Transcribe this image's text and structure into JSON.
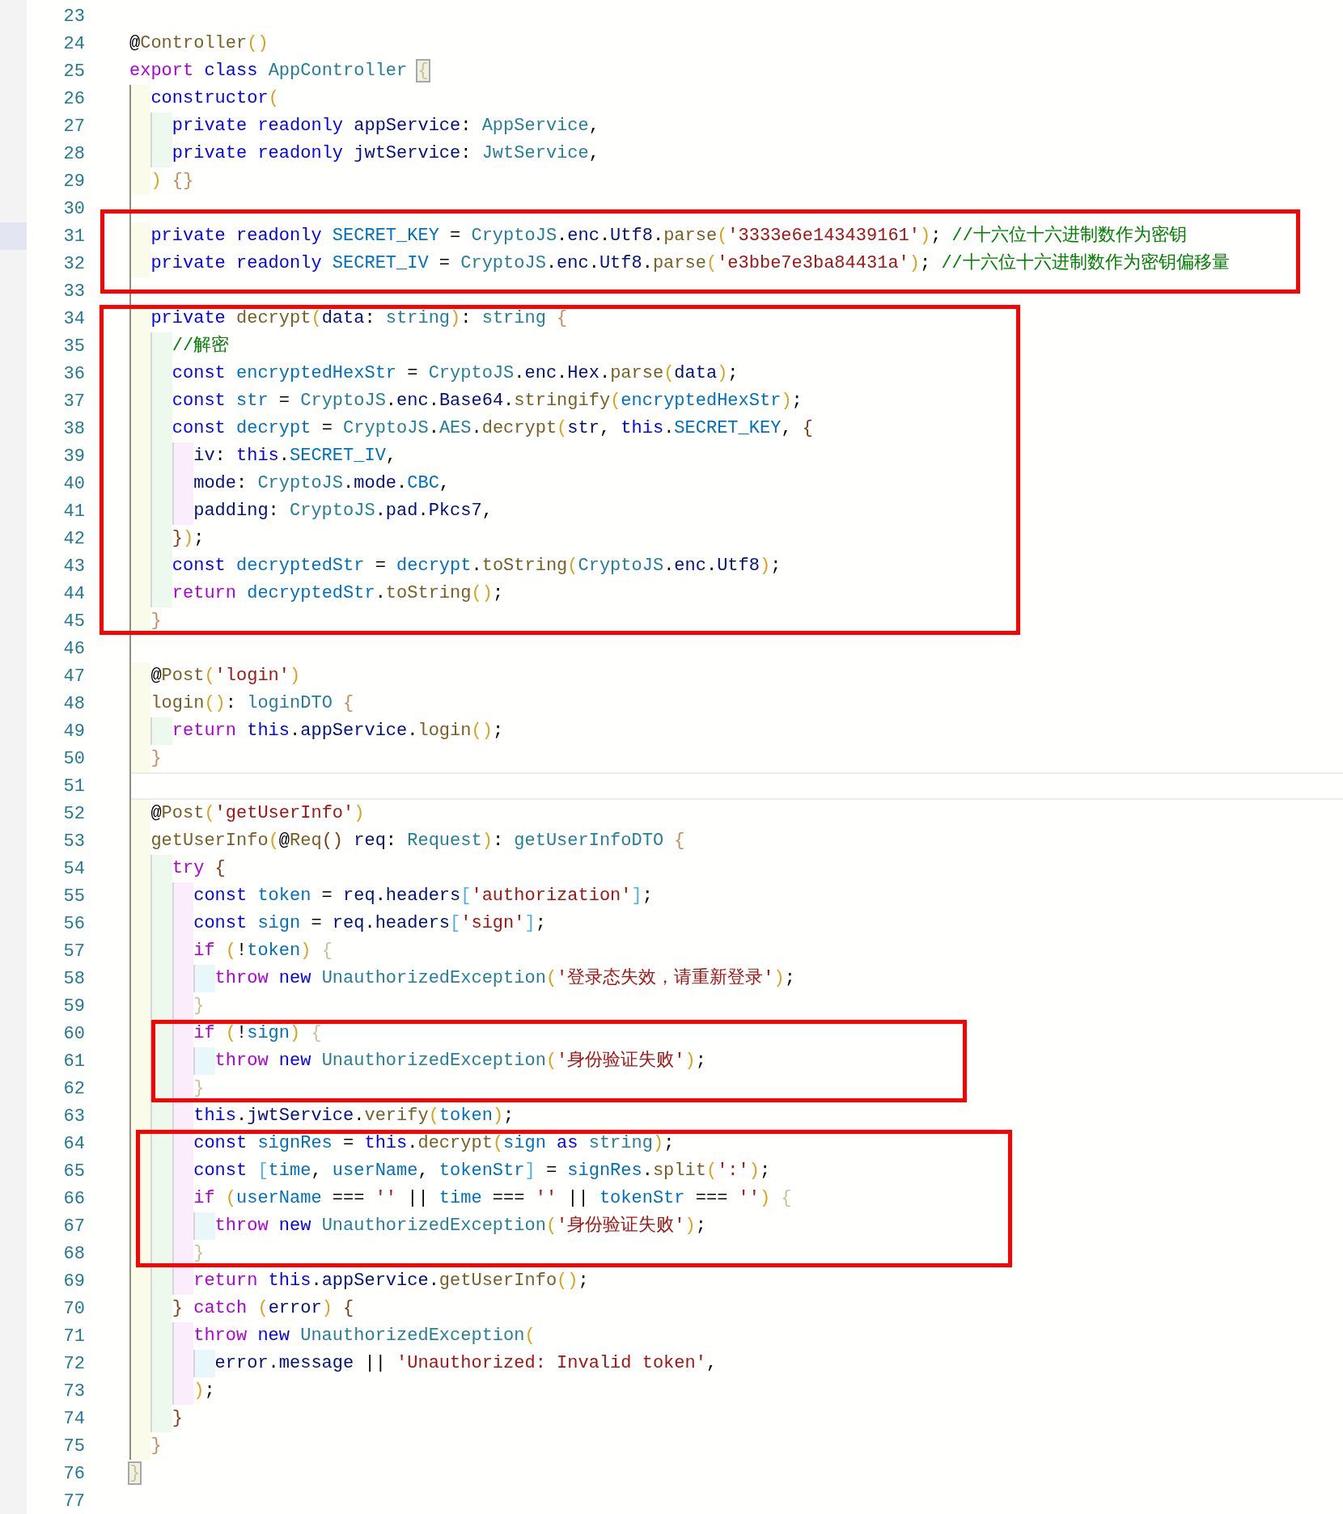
{
  "blocks": [
    {
      "boxed": false,
      "lines": [
        {
          "number": "23",
          "kind": "plain"
        },
        {
          "number": "24",
          "kind": "plain",
          "tokens": [
            {
              "text": "@",
              "kind": "punct"
            },
            {
              "text": "Controller",
              "kind": "function"
            },
            {
              "text": "()",
              "kind": "bracket-gold"
            }
          ]
        },
        {
          "number": "25",
          "kind": "plain",
          "tokens": [
            {
              "text": "export ",
              "kind": "control"
            },
            {
              "text": "class ",
              "kind": "keyword"
            },
            {
              "text": "AppController ",
              "kind": "type"
            },
            {
              "text": "{",
              "kind": "bracket-match"
            }
          ]
        },
        {
          "number": "26",
          "kind": "plain",
          "tokens": [
            {
              "text": "  constructor",
              "kind": "keyword"
            },
            {
              "text": "(",
              "kind": "bracket-gold"
            }
          ]
        },
        {
          "number": "27",
          "kind": "plain",
          "tokens": [
            {
              "text": "    private readonly ",
              "kind": "keyword"
            },
            {
              "text": "appService",
              "kind": "variable"
            },
            {
              "text": ": ",
              "kind": "punct"
            },
            {
              "text": "AppService",
              "kind": "type"
            },
            {
              "text": ",",
              "kind": "punct"
            }
          ]
        },
        {
          "number": "28",
          "kind": "plain",
          "tokens": [
            {
              "text": "    private readonly ",
              "kind": "keyword"
            },
            {
              "text": "jwtService",
              "kind": "variable"
            },
            {
              "text": ": ",
              "kind": "punct"
            },
            {
              "text": "JwtService",
              "kind": "type"
            },
            {
              "text": ",",
              "kind": "punct"
            }
          ]
        },
        {
          "number": "29",
          "kind": "plain",
          "tokens": [
            {
              "text": "  ) ",
              "kind": "bracket-gold"
            },
            {
              "text": "{}",
              "kind": "bracket-tan"
            }
          ]
        },
        {
          "number": "30",
          "kind": "plain"
        }
      ]
    },
    {
      "boxed": true,
      "lines": [
        {
          "number": "31",
          "kind": "marked",
          "tokens": [
            {
              "text": "  private readonly ",
              "kind": "keyword"
            },
            {
              "text": "SECRET_KEY",
              "kind": "constant"
            },
            {
              "text": " = ",
              "kind": "punct"
            },
            {
              "text": "CryptoJS",
              "kind": "type"
            },
            {
              "text": ".",
              "kind": "punct"
            },
            {
              "text": "enc",
              "kind": "variable"
            },
            {
              "text": ".",
              "kind": "punct"
            },
            {
              "text": "Utf8",
              "kind": "variable"
            },
            {
              "text": ".",
              "kind": "punct"
            },
            {
              "text": "parse",
              "kind": "function"
            },
            {
              "text": "(",
              "kind": "bracket-gold"
            },
            {
              "text": "'3333e6e143439161'",
              "kind": "string"
            },
            {
              "text": ")",
              "kind": "bracket-gold"
            },
            {
              "text": "; ",
              "kind": "punct"
            },
            {
              "text": "//十六位十六进制数作为密钥",
              "kind": "comment"
            }
          ]
        },
        {
          "number": "32",
          "kind": "plain",
          "tokens": [
            {
              "text": "  private readonly ",
              "kind": "keyword"
            },
            {
              "text": "SECRET_IV",
              "kind": "constant"
            },
            {
              "text": " = ",
              "kind": "punct"
            },
            {
              "text": "CryptoJS",
              "kind": "type"
            },
            {
              "text": ".",
              "kind": "punct"
            },
            {
              "text": "enc",
              "kind": "variable"
            },
            {
              "text": ".",
              "kind": "punct"
            },
            {
              "text": "Utf8",
              "kind": "variable"
            },
            {
              "text": ".",
              "kind": "punct"
            },
            {
              "text": "parse",
              "kind": "function"
            },
            {
              "text": "(",
              "kind": "bracket-gold"
            },
            {
              "text": "'e3bbe7e3ba84431a'",
              "kind": "string"
            },
            {
              "text": ")",
              "kind": "bracket-gold"
            },
            {
              "text": "; ",
              "kind": "punct"
            },
            {
              "text": "//十六位十六进制数作为密钥偏移量",
              "kind": "comment"
            }
          ]
        },
        {
          "number": "33",
          "kind": "plain"
        }
      ]
    },
    {
      "boxed": true,
      "lines": [
        {
          "number": "34",
          "kind": "plain",
          "tokens": [
            {
              "text": "  private ",
              "kind": "keyword"
            },
            {
              "text": "decrypt",
              "kind": "function"
            },
            {
              "text": "(",
              "kind": "bracket-gold"
            },
            {
              "text": "data",
              "kind": "variable"
            },
            {
              "text": ": ",
              "kind": "punct"
            },
            {
              "text": "string",
              "kind": "type"
            },
            {
              "text": ")",
              "kind": "bracket-gold"
            },
            {
              "text": ": ",
              "kind": "punct"
            },
            {
              "text": "string ",
              "kind": "type"
            },
            {
              "text": "{",
              "kind": "bracket-tan"
            }
          ]
        },
        {
          "number": "35",
          "kind": "plain",
          "tokens": [
            {
              "text": "    //解密",
              "kind": "comment"
            }
          ]
        },
        {
          "number": "36",
          "kind": "plain",
          "tokens": [
            {
              "text": "    const ",
              "kind": "keyword"
            },
            {
              "text": "encryptedHexStr",
              "kind": "constant"
            },
            {
              "text": " = ",
              "kind": "punct"
            },
            {
              "text": "CryptoJS",
              "kind": "type"
            },
            {
              "text": ".",
              "kind": "punct"
            },
            {
              "text": "enc",
              "kind": "variable"
            },
            {
              "text": ".",
              "kind": "punct"
            },
            {
              "text": "Hex",
              "kind": "variable"
            },
            {
              "text": ".",
              "kind": "punct"
            },
            {
              "text": "parse",
              "kind": "function"
            },
            {
              "text": "(",
              "kind": "bracket-gold"
            },
            {
              "text": "data",
              "kind": "variable"
            },
            {
              "text": ")",
              "kind": "bracket-gold"
            },
            {
              "text": ";",
              "kind": "punct"
            }
          ]
        },
        {
          "number": "37",
          "kind": "plain",
          "tokens": [
            {
              "text": "    const ",
              "kind": "keyword"
            },
            {
              "text": "str",
              "kind": "constant"
            },
            {
              "text": " = ",
              "kind": "punct"
            },
            {
              "text": "CryptoJS",
              "kind": "type"
            },
            {
              "text": ".",
              "kind": "punct"
            },
            {
              "text": "enc",
              "kind": "variable"
            },
            {
              "text": ".",
              "kind": "punct"
            },
            {
              "text": "Base64",
              "kind": "variable"
            },
            {
              "text": ".",
              "kind": "punct"
            },
            {
              "text": "stringify",
              "kind": "function"
            },
            {
              "text": "(",
              "kind": "bracket-gold"
            },
            {
              "text": "encryptedHexStr",
              "kind": "constant"
            },
            {
              "text": ")",
              "kind": "bracket-gold"
            },
            {
              "text": ";",
              "kind": "punct"
            }
          ]
        },
        {
          "number": "38",
          "kind": "plain",
          "tokens": [
            {
              "text": "    const ",
              "kind": "keyword"
            },
            {
              "text": "decrypt",
              "kind": "constant"
            },
            {
              "text": " = ",
              "kind": "punct"
            },
            {
              "text": "CryptoJS",
              "kind": "type"
            },
            {
              "text": ".",
              "kind": "punct"
            },
            {
              "text": "AES",
              "kind": "type"
            },
            {
              "text": ".",
              "kind": "punct"
            },
            {
              "text": "decrypt",
              "kind": "function"
            },
            {
              "text": "(",
              "kind": "bracket-gold"
            },
            {
              "text": "str",
              "kind": "variable"
            },
            {
              "text": ", ",
              "kind": "punct"
            },
            {
              "text": "this",
              "kind": "keyword"
            },
            {
              "text": ".",
              "kind": "punct"
            },
            {
              "text": "SECRET_KEY",
              "kind": "constant"
            },
            {
              "text": ", ",
              "kind": "punct"
            },
            {
              "text": "{",
              "kind": "bracket-brown"
            }
          ]
        },
        {
          "number": "39",
          "kind": "plain",
          "tokens": [
            {
              "text": "      iv",
              "kind": "variable"
            },
            {
              "text": ": ",
              "kind": "punct"
            },
            {
              "text": "this",
              "kind": "keyword"
            },
            {
              "text": ".",
              "kind": "punct"
            },
            {
              "text": "SECRET_IV",
              "kind": "constant"
            },
            {
              "text": ",",
              "kind": "punct"
            }
          ]
        },
        {
          "number": "40",
          "kind": "plain",
          "tokens": [
            {
              "text": "      mode",
              "kind": "variable"
            },
            {
              "text": ": ",
              "kind": "punct"
            },
            {
              "text": "CryptoJS",
              "kind": "type"
            },
            {
              "text": ".",
              "kind": "punct"
            },
            {
              "text": "mode",
              "kind": "variable"
            },
            {
              "text": ".",
              "kind": "punct"
            },
            {
              "text": "CBC",
              "kind": "constant"
            },
            {
              "text": ",",
              "kind": "punct"
            }
          ]
        },
        {
          "number": "41",
          "kind": "plain",
          "tokens": [
            {
              "text": "      padding",
              "kind": "variable"
            },
            {
              "text": ": ",
              "kind": "punct"
            },
            {
              "text": "CryptoJS",
              "kind": "type"
            },
            {
              "text": ".",
              "kind": "punct"
            },
            {
              "text": "pad",
              "kind": "variable"
            },
            {
              "text": ".",
              "kind": "punct"
            },
            {
              "text": "Pkcs7",
              "kind": "variable"
            },
            {
              "text": ",",
              "kind": "punct"
            }
          ]
        },
        {
          "number": "42",
          "kind": "plain",
          "tokens": [
            {
              "text": "    }",
              "kind": "bracket-brown"
            },
            {
              "text": ")",
              "kind": "bracket-gold"
            },
            {
              "text": ";",
              "kind": "punct"
            }
          ]
        },
        {
          "number": "43",
          "kind": "plain",
          "tokens": [
            {
              "text": "    const ",
              "kind": "keyword"
            },
            {
              "text": "decryptedStr",
              "kind": "constant"
            },
            {
              "text": " = ",
              "kind": "punct"
            },
            {
              "text": "decrypt",
              "kind": "constant"
            },
            {
              "text": ".",
              "kind": "punct"
            },
            {
              "text": "toString",
              "kind": "function"
            },
            {
              "text": "(",
              "kind": "bracket-gold"
            },
            {
              "text": "CryptoJS",
              "kind": "type"
            },
            {
              "text": ".",
              "kind": "punct"
            },
            {
              "text": "enc",
              "kind": "variable"
            },
            {
              "text": ".",
              "kind": "punct"
            },
            {
              "text": "Utf8",
              "kind": "variable"
            },
            {
              "text": ")",
              "kind": "bracket-gold"
            },
            {
              "text": ";",
              "kind": "punct"
            }
          ]
        },
        {
          "number": "44",
          "kind": "plain",
          "tokens": [
            {
              "text": "    return ",
              "kind": "control"
            },
            {
              "text": "decryptedStr",
              "kind": "constant"
            },
            {
              "text": ".",
              "kind": "punct"
            },
            {
              "text": "toString",
              "kind": "function"
            },
            {
              "text": "()",
              "kind": "bracket-gold"
            },
            {
              "text": ";",
              "kind": "punct"
            }
          ]
        },
        {
          "number": "45",
          "kind": "plain",
          "tokens": [
            {
              "text": "  }",
              "kind": "bracket-tan"
            }
          ]
        }
      ]
    },
    {
      "boxed": false,
      "lines": [
        {
          "number": "46",
          "kind": "plain"
        },
        {
          "number": "47",
          "kind": "plain",
          "tokens": [
            {
              "text": "  @",
              "kind": "punct"
            },
            {
              "text": "Post",
              "kind": "function"
            },
            {
              "text": "(",
              "kind": "bracket-gold"
            },
            {
              "text": "'login'",
              "kind": "string"
            },
            {
              "text": ")",
              "kind": "bracket-gold"
            }
          ]
        },
        {
          "number": "48",
          "kind": "plain",
          "tokens": [
            {
              "text": "  login",
              "kind": "function"
            },
            {
              "text": "()",
              "kind": "bracket-gold"
            },
            {
              "text": ": ",
              "kind": "punct"
            },
            {
              "text": "loginDTO ",
              "kind": "type"
            },
            {
              "text": "{",
              "kind": "bracket-tan"
            }
          ]
        },
        {
          "number": "49",
          "kind": "plain",
          "tokens": [
            {
              "text": "    return ",
              "kind": "control"
            },
            {
              "text": "this",
              "kind": "keyword"
            },
            {
              "text": ".",
              "kind": "punct"
            },
            {
              "text": "appService",
              "kind": "variable"
            },
            {
              "text": ".",
              "kind": "punct"
            },
            {
              "text": "login",
              "kind": "function"
            },
            {
              "text": "()",
              "kind": "bracket-gold"
            },
            {
              "text": ";",
              "kind": "punct"
            }
          ]
        },
        {
          "number": "50",
          "kind": "plain",
          "tokens": [
            {
              "text": "  }",
              "kind": "bracket-tan"
            }
          ]
        },
        {
          "number": "51",
          "kind": "current"
        },
        {
          "number": "52",
          "kind": "plain",
          "tokens": [
            {
              "text": "  @",
              "kind": "punct"
            },
            {
              "text": "Post",
              "kind": "function"
            },
            {
              "text": "(",
              "kind": "bracket-gold"
            },
            {
              "text": "'getUserInfo'",
              "kind": "string"
            },
            {
              "text": ")",
              "kind": "bracket-gold"
            }
          ]
        },
        {
          "number": "53",
          "kind": "plain",
          "tokens": [
            {
              "text": "  getUserInfo",
              "kind": "function"
            },
            {
              "text": "(",
              "kind": "bracket-gold"
            },
            {
              "text": "@",
              "kind": "punct"
            },
            {
              "text": "Req",
              "kind": "function"
            },
            {
              "text": "() ",
              "kind": "bracket-brown"
            },
            {
              "text": "req",
              "kind": "variable"
            },
            {
              "text": ": ",
              "kind": "punct"
            },
            {
              "text": "Request",
              "kind": "type"
            },
            {
              "text": ")",
              "kind": "bracket-gold"
            },
            {
              "text": ": ",
              "kind": "punct"
            },
            {
              "text": "getUserInfoDTO ",
              "kind": "type"
            },
            {
              "text": "{",
              "kind": "bracket-tan"
            }
          ]
        },
        {
          "number": "54",
          "kind": "plain",
          "tokens": [
            {
              "text": "    try ",
              "kind": "control"
            },
            {
              "text": "{",
              "kind": "bracket-brown"
            }
          ]
        },
        {
          "number": "55",
          "kind": "plain",
          "tokens": [
            {
              "text": "      const ",
              "kind": "keyword"
            },
            {
              "text": "token",
              "kind": "constant"
            },
            {
              "text": " = ",
              "kind": "punct"
            },
            {
              "text": "req",
              "kind": "variable"
            },
            {
              "text": ".",
              "kind": "punct"
            },
            {
              "text": "headers",
              "kind": "variable"
            },
            {
              "text": "[",
              "kind": "bracket-blue"
            },
            {
              "text": "'authorization'",
              "kind": "string"
            },
            {
              "text": "]",
              "kind": "bracket-blue"
            },
            {
              "text": ";",
              "kind": "punct"
            }
          ]
        },
        {
          "number": "56",
          "kind": "plain",
          "tokens": [
            {
              "text": "      const ",
              "kind": "keyword"
            },
            {
              "text": "sign",
              "kind": "constant"
            },
            {
              "text": " = ",
              "kind": "punct"
            },
            {
              "text": "req",
              "kind": "variable"
            },
            {
              "text": ".",
              "kind": "punct"
            },
            {
              "text": "headers",
              "kind": "variable"
            },
            {
              "text": "[",
              "kind": "bracket-blue"
            },
            {
              "text": "'sign'",
              "kind": "string"
            },
            {
              "text": "]",
              "kind": "bracket-blue"
            },
            {
              "text": ";",
              "kind": "punct"
            }
          ]
        },
        {
          "number": "57",
          "kind": "plain",
          "tokens": [
            {
              "text": "      if ",
              "kind": "control"
            },
            {
              "text": "(",
              "kind": "bracket-gold"
            },
            {
              "text": "!",
              "kind": "punct"
            },
            {
              "text": "token",
              "kind": "constant"
            },
            {
              "text": ") ",
              "kind": "bracket-gold"
            },
            {
              "text": "{",
              "kind": "bracket-pale"
            }
          ]
        },
        {
          "number": "58",
          "kind": "plain",
          "tokens": [
            {
              "text": "        throw ",
              "kind": "control"
            },
            {
              "text": "new ",
              "kind": "keyword"
            },
            {
              "text": "UnauthorizedException",
              "kind": "type"
            },
            {
              "text": "(",
              "kind": "bracket-gold"
            },
            {
              "text": "'登录态失效，请重新登录'",
              "kind": "string"
            },
            {
              "text": ")",
              "kind": "bracket-gold"
            },
            {
              "text": ";",
              "kind": "punct"
            }
          ]
        },
        {
          "number": "59",
          "kind": "plain",
          "tokens": [
            {
              "text": "      }",
              "kind": "bracket-pale"
            }
          ]
        }
      ]
    },
    {
      "boxed": true,
      "lines": [
        {
          "number": "60",
          "kind": "plain",
          "tokens": [
            {
              "text": "      if ",
              "kind": "control"
            },
            {
              "text": "(",
              "kind": "bracket-gold"
            },
            {
              "text": "!",
              "kind": "punct"
            },
            {
              "text": "sign",
              "kind": "constant"
            },
            {
              "text": ") ",
              "kind": "bracket-gold"
            },
            {
              "text": "{",
              "kind": "bracket-pale"
            }
          ]
        },
        {
          "number": "61",
          "kind": "plain",
          "tokens": [
            {
              "text": "        throw ",
              "kind": "control"
            },
            {
              "text": "new ",
              "kind": "keyword"
            },
            {
              "text": "UnauthorizedException",
              "kind": "type"
            },
            {
              "text": "(",
              "kind": "bracket-gold"
            },
            {
              "text": "'身份验证失败'",
              "kind": "string"
            },
            {
              "text": ")",
              "kind": "bracket-gold"
            },
            {
              "text": ";",
              "kind": "punct"
            }
          ]
        },
        {
          "number": "62",
          "kind": "plain",
          "tokens": [
            {
              "text": "      }",
              "kind": "bracket-pale"
            }
          ]
        }
      ]
    },
    {
      "boxed": false,
      "lines": [
        {
          "number": "63",
          "kind": "plain",
          "tokens": [
            {
              "text": "      this",
              "kind": "keyword"
            },
            {
              "text": ".",
              "kind": "punct"
            },
            {
              "text": "jwtService",
              "kind": "variable"
            },
            {
              "text": ".",
              "kind": "punct"
            },
            {
              "text": "verify",
              "kind": "function"
            },
            {
              "text": "(",
              "kind": "bracket-gold"
            },
            {
              "text": "token",
              "kind": "constant"
            },
            {
              "text": ")",
              "kind": "bracket-gold"
            },
            {
              "text": ";",
              "kind": "punct"
            }
          ]
        }
      ]
    },
    {
      "boxed": true,
      "lines": [
        {
          "number": "64",
          "kind": "plain",
          "tokens": [
            {
              "text": "      const ",
              "kind": "keyword"
            },
            {
              "text": "signRes",
              "kind": "constant"
            },
            {
              "text": " = ",
              "kind": "punct"
            },
            {
              "text": "this",
              "kind": "keyword"
            },
            {
              "text": ".",
              "kind": "punct"
            },
            {
              "text": "decrypt",
              "kind": "function"
            },
            {
              "text": "(",
              "kind": "bracket-gold"
            },
            {
              "text": "sign ",
              "kind": "constant"
            },
            {
              "text": "as ",
              "kind": "keyword"
            },
            {
              "text": "string",
              "kind": "type"
            },
            {
              "text": ")",
              "kind": "bracket-gold"
            },
            {
              "text": ";",
              "kind": "punct"
            }
          ]
        },
        {
          "number": "65",
          "kind": "plain",
          "tokens": [
            {
              "text": "      const ",
              "kind": "keyword"
            },
            {
              "text": "[",
              "kind": "bracket-blue"
            },
            {
              "text": "time",
              "kind": "constant"
            },
            {
              "text": ", ",
              "kind": "punct"
            },
            {
              "text": "userName",
              "kind": "constant"
            },
            {
              "text": ", ",
              "kind": "punct"
            },
            {
              "text": "tokenStr",
              "kind": "constant"
            },
            {
              "text": "]",
              "kind": "bracket-blue"
            },
            {
              "text": " = ",
              "kind": "punct"
            },
            {
              "text": "signRes",
              "kind": "constant"
            },
            {
              "text": ".",
              "kind": "punct"
            },
            {
              "text": "split",
              "kind": "function"
            },
            {
              "text": "(",
              "kind": "bracket-gold"
            },
            {
              "text": "':'",
              "kind": "string"
            },
            {
              "text": ")",
              "kind": "bracket-gold"
            },
            {
              "text": ";",
              "kind": "punct"
            }
          ]
        },
        {
          "number": "66",
          "kind": "plain",
          "tokens": [
            {
              "text": "      if ",
              "kind": "control"
            },
            {
              "text": "(",
              "kind": "bracket-gold"
            },
            {
              "text": "userName",
              "kind": "constant"
            },
            {
              "text": " === ",
              "kind": "punct"
            },
            {
              "text": "''",
              "kind": "string"
            },
            {
              "text": " || ",
              "kind": "punct"
            },
            {
              "text": "time",
              "kind": "constant"
            },
            {
              "text": " === ",
              "kind": "punct"
            },
            {
              "text": "''",
              "kind": "string"
            },
            {
              "text": " || ",
              "kind": "punct"
            },
            {
              "text": "tokenStr",
              "kind": "constant"
            },
            {
              "text": " === ",
              "kind": "punct"
            },
            {
              "text": "''",
              "kind": "string"
            },
            {
              "text": ") ",
              "kind": "bracket-gold"
            },
            {
              "text": "{",
              "kind": "bracket-pale"
            }
          ]
        },
        {
          "number": "67",
          "kind": "plain",
          "tokens": [
            {
              "text": "        throw ",
              "kind": "control"
            },
            {
              "text": "new ",
              "kind": "keyword"
            },
            {
              "text": "UnauthorizedException",
              "kind": "type"
            },
            {
              "text": "(",
              "kind": "bracket-gold"
            },
            {
              "text": "'身份验证失败'",
              "kind": "string"
            },
            {
              "text": ")",
              "kind": "bracket-gold"
            },
            {
              "text": ";",
              "kind": "punct"
            }
          ]
        },
        {
          "number": "68",
          "kind": "plain",
          "tokens": [
            {
              "text": "      }",
              "kind": "bracket-pale"
            }
          ]
        }
      ]
    },
    {
      "boxed": false,
      "lines": [
        {
          "number": "69",
          "kind": "plain",
          "tokens": [
            {
              "text": "      return ",
              "kind": "control"
            },
            {
              "text": "this",
              "kind": "keyword"
            },
            {
              "text": ".",
              "kind": "punct"
            },
            {
              "text": "appService",
              "kind": "variable"
            },
            {
              "text": ".",
              "kind": "punct"
            },
            {
              "text": "getUserInfo",
              "kind": "function"
            },
            {
              "text": "()",
              "kind": "bracket-gold"
            },
            {
              "text": ";",
              "kind": "punct"
            }
          ]
        },
        {
          "number": "70",
          "kind": "plain",
          "tokens": [
            {
              "text": "    } ",
              "kind": "bracket-brown"
            },
            {
              "text": "catch ",
              "kind": "control"
            },
            {
              "text": "(",
              "kind": "bracket-gold"
            },
            {
              "text": "error",
              "kind": "variable"
            },
            {
              "text": ") ",
              "kind": "bracket-gold"
            },
            {
              "text": "{",
              "kind": "bracket-brown"
            }
          ]
        },
        {
          "number": "71",
          "kind": "plain",
          "tokens": [
            {
              "text": "      throw ",
              "kind": "control"
            },
            {
              "text": "new ",
              "kind": "keyword"
            },
            {
              "text": "UnauthorizedException",
              "kind": "type"
            },
            {
              "text": "(",
              "kind": "bracket-gold"
            }
          ]
        },
        {
          "number": "72",
          "kind": "plain",
          "tokens": [
            {
              "text": "        error",
              "kind": "variable"
            },
            {
              "text": ".",
              "kind": "punct"
            },
            {
              "text": "message",
              "kind": "variable"
            },
            {
              "text": " || ",
              "kind": "punct"
            },
            {
              "text": "'Unauthorized: Invalid token'",
              "kind": "string"
            },
            {
              "text": ",",
              "kind": "punct"
            }
          ]
        },
        {
          "number": "73",
          "kind": "plain",
          "tokens": [
            {
              "text": "      )",
              "kind": "bracket-gold"
            },
            {
              "text": ";",
              "kind": "punct"
            }
          ]
        },
        {
          "number": "74",
          "kind": "plain",
          "tokens": [
            {
              "text": "    }",
              "kind": "bracket-brown"
            }
          ]
        },
        {
          "number": "75",
          "kind": "plain",
          "tokens": [
            {
              "text": "  }",
              "kind": "bracket-tan"
            }
          ]
        },
        {
          "number": "76",
          "kind": "plain",
          "tokens": [
            {
              "text": "}",
              "kind": "bracket-match"
            }
          ]
        },
        {
          "number": "77",
          "kind": "plain"
        }
      ]
    }
  ]
}
